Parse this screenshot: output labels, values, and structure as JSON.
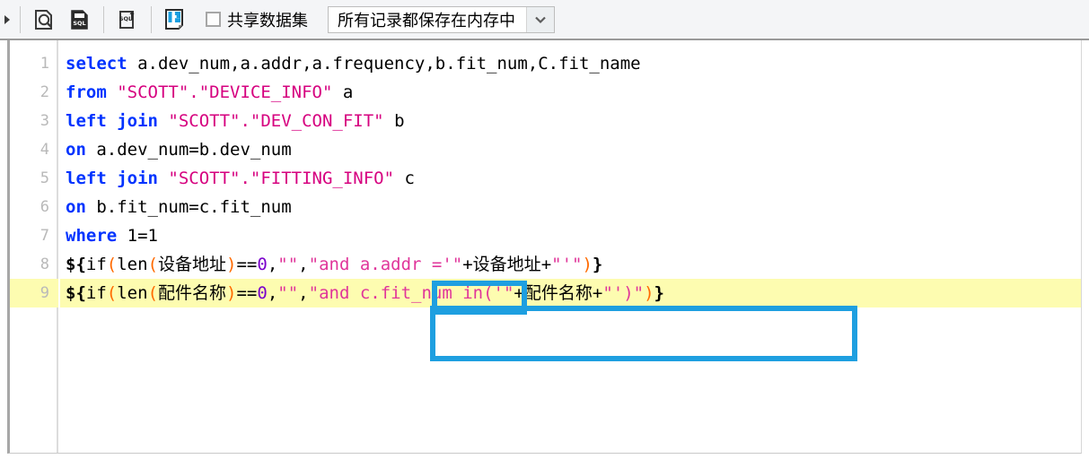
{
  "toolbar": {
    "collapse_arrow": "▶",
    "buttons": [
      {
        "name": "sql-preview-icon",
        "title": "预览SQL"
      },
      {
        "name": "sql-edit-icon",
        "title": "编辑SQL"
      },
      {
        "name": "sql-export-icon",
        "title": "导出SQL"
      },
      {
        "name": "save-dataset-icon",
        "title": "保存数据集"
      }
    ],
    "checkbox": {
      "label": "共享数据集",
      "checked": false
    },
    "combo": {
      "value": "所有记录都保存在内存中",
      "caret": "⌄"
    }
  },
  "editor": {
    "gutter_numbers": [
      "1",
      "2",
      "3",
      "4",
      "5",
      "6",
      "7",
      "8",
      "9"
    ],
    "highlighted_line": 9,
    "lines": [
      {
        "number": "1",
        "text": "select a.dev_num,a.addr,a.frequency,b.fit_num,C.fit_name",
        "tokens": [
          {
            "t": "select",
            "c": "kw"
          },
          {
            "t": " a.dev_num,a.addr,a.frequency,b.fit_num,C.fit_name",
            "c": "plain"
          }
        ]
      },
      {
        "number": "2",
        "text": "from \"SCOTT\".\"DEVICE_INFO\" a",
        "tokens": [
          {
            "t": "from",
            "c": "kw"
          },
          {
            "t": " ",
            "c": "plain"
          },
          {
            "t": "\"SCOTT\".\"DEVICE_INFO\"",
            "c": "str"
          },
          {
            "t": " a",
            "c": "plain"
          }
        ]
      },
      {
        "number": "3",
        "text": "left join \"SCOTT\".\"DEV_CON_FIT\" b",
        "tokens": [
          {
            "t": "left join",
            "c": "kw"
          },
          {
            "t": " ",
            "c": "plain"
          },
          {
            "t": "\"SCOTT\".\"DEV_CON_FIT\"",
            "c": "str"
          },
          {
            "t": " b",
            "c": "plain"
          }
        ]
      },
      {
        "number": "4",
        "text": "on a.dev_num=b.dev_num",
        "tokens": [
          {
            "t": "on",
            "c": "kw"
          },
          {
            "t": " a.dev_num=b.dev_num",
            "c": "plain"
          }
        ]
      },
      {
        "number": "5",
        "text": "left join \"SCOTT\".\"FITTING_INFO\" c",
        "tokens": [
          {
            "t": "left join",
            "c": "kw"
          },
          {
            "t": " ",
            "c": "plain"
          },
          {
            "t": "\"SCOTT\".\"FITTING_INFO\"",
            "c": "str"
          },
          {
            "t": " c",
            "c": "plain"
          }
        ]
      },
      {
        "number": "6",
        "text": "on b.fit_num=c.fit_num",
        "tokens": [
          {
            "t": "on",
            "c": "kw"
          },
          {
            "t": " b.fit_num=c.fit_num",
            "c": "plain"
          }
        ]
      },
      {
        "number": "7",
        "text": "where 1=1",
        "tokens": [
          {
            "t": "where",
            "c": "kw"
          },
          {
            "t": " ",
            "c": "plain"
          },
          {
            "t": "1=1",
            "c": "plain"
          }
        ]
      },
      {
        "number": "8",
        "text": "${if(len(设备地址)==0,\"\",\"and a.addr ='\"+设备地址+\"'\")}",
        "tokens": [
          {
            "t": "${",
            "c": "brace"
          },
          {
            "t": "if",
            "c": "fn"
          },
          {
            "t": "(",
            "c": "paren"
          },
          {
            "t": "len",
            "c": "fn"
          },
          {
            "t": "(",
            "c": "paren"
          },
          {
            "t": "设备地址",
            "c": "plain"
          },
          {
            "t": ")",
            "c": "paren"
          },
          {
            "t": "==",
            "c": "plain"
          },
          {
            "t": "0",
            "c": "num"
          },
          {
            "t": ",",
            "c": "plain"
          },
          {
            "t": "\"\"",
            "c": "pink"
          },
          {
            "t": ",",
            "c": "plain"
          },
          {
            "t": "\"and a.addr ='\"",
            "c": "pink"
          },
          {
            "t": "+",
            "c": "plain"
          },
          {
            "t": "设备地址",
            "c": "plain"
          },
          {
            "t": "+",
            "c": "plain"
          },
          {
            "t": "\"'\"",
            "c": "pink"
          },
          {
            "t": ")",
            "c": "paren"
          },
          {
            "t": "}",
            "c": "brace"
          }
        ]
      },
      {
        "number": "9",
        "text": "${if(len(配件名称)==0,\"\",\"and c.fit_num in('\"+配件名称+\"')\")}",
        "tokens": [
          {
            "t": "${",
            "c": "brace"
          },
          {
            "t": "if",
            "c": "fn"
          },
          {
            "t": "(",
            "c": "paren"
          },
          {
            "t": "len",
            "c": "fn"
          },
          {
            "t": "(",
            "c": "paren"
          },
          {
            "t": "配件名称",
            "c": "plain"
          },
          {
            "t": ")",
            "c": "paren"
          },
          {
            "t": "==",
            "c": "plain"
          },
          {
            "t": "0",
            "c": "num"
          },
          {
            "t": ",",
            "c": "plain"
          },
          {
            "t": "\"\"",
            "c": "pink"
          },
          {
            "t": ",",
            "c": "plain"
          },
          {
            "t": "\"and c.fit_num in('\"",
            "c": "pink"
          },
          {
            "t": "+",
            "c": "plain"
          },
          {
            "t": "配件名称",
            "c": "plain"
          },
          {
            "t": "+",
            "c": "plain"
          },
          {
            "t": "\"')\"",
            "c": "pink"
          },
          {
            "t": ")",
            "c": "paren"
          },
          {
            "t": "}",
            "c": "brace"
          }
        ]
      }
    ]
  },
  "annotations": {
    "color": "#1e9fe0",
    "boxes": [
      {
        "name": "annotation-box-a-addr",
        "target": "a.addr"
      },
      {
        "name": "annotation-box-line-9",
        "target": "c.fit_num in('\"+配件名称+\"')"
      }
    ]
  },
  "colors": {
    "keyword": "#0033ff",
    "string": "#d6007f",
    "pink_string": "#e0359a",
    "paren": "#ff6a00",
    "number": "#7a00cc",
    "line_highlight": "#fdfcb0",
    "gutter_text": "#b9b9b9",
    "annotation": "#1e9fe0",
    "toolbar_bg": "#f4f5f7"
  }
}
